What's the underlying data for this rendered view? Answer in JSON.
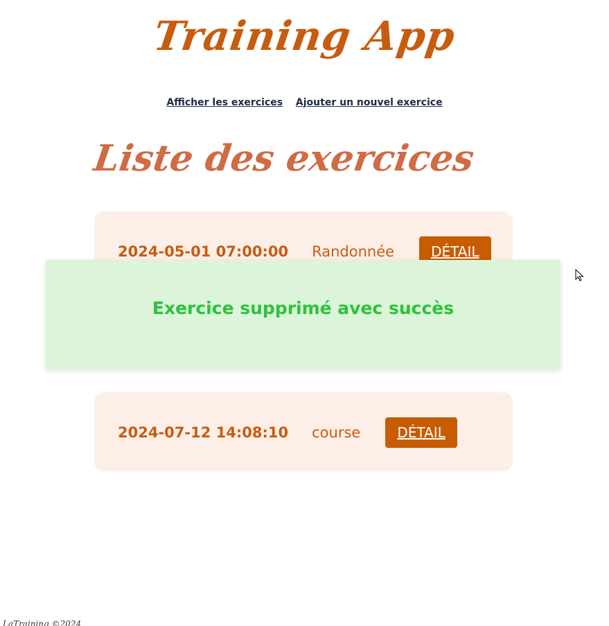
{
  "header": {
    "app_title": "Training App"
  },
  "nav": {
    "show_exercises": "Afficher les exercices",
    "add_exercise": "Ajouter un nouvel exercice"
  },
  "main": {
    "section_title": "Liste des exercices",
    "exercises": [
      {
        "date": "2024-05-01 07:00:00",
        "type": "Randonnée",
        "detail_label": "DÉTAIL"
      },
      {
        "date": "2024-07-12 14:08:10",
        "type": "course",
        "detail_label": "DÉTAIL"
      }
    ]
  },
  "toast": {
    "message": "Exercice supprimé avec succès"
  },
  "footer": {
    "text": "LaTraining ©2024"
  },
  "colors": {
    "brand": "#c75c10",
    "card_bg": "#fdefe8",
    "toast_bg": "#dcf4d9",
    "toast_text": "#2ec23d"
  }
}
